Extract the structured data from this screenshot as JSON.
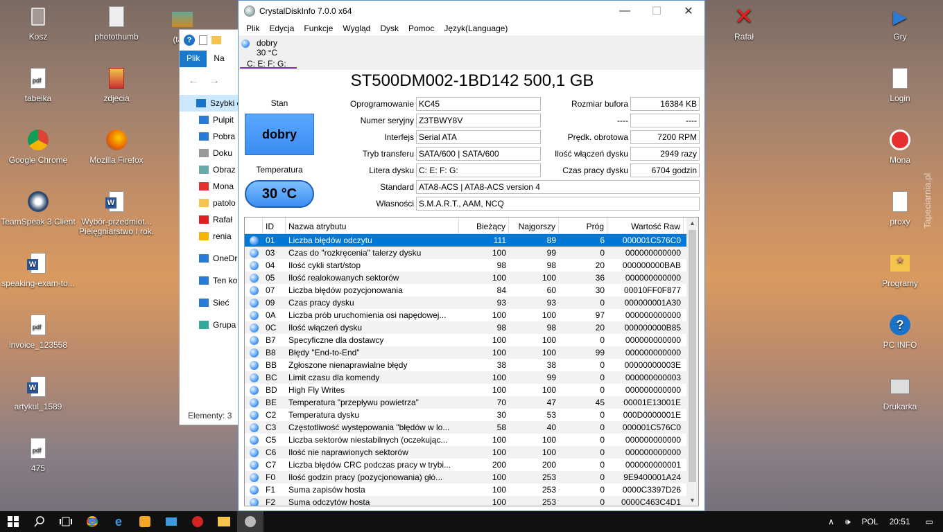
{
  "desktop_left": [
    {
      "label": "Kosz",
      "icon": "recycle-bin-icon"
    },
    {
      "label": "photothumb",
      "icon": "settings-file-icon"
    },
    {
      "label": "(tape",
      "icon": "image-file-icon"
    },
    {
      "label": "tabelka",
      "icon": "pdf-file-icon"
    },
    {
      "label": "zdjecia",
      "icon": "archive-file-icon"
    },
    {
      "label": "Google Chrome",
      "icon": "chrome-icon"
    },
    {
      "label": "Mozilla Firefox",
      "icon": "firefox-icon"
    },
    {
      "label": "TeamSpeak 3 Client",
      "icon": "teamspeak-icon"
    },
    {
      "label": "Wybór-przedmiot... Pielęgniarstwo I rok.",
      "icon": "word-file-icon"
    },
    {
      "label": "speaking-exam-to...",
      "icon": "word-file-icon"
    },
    {
      "label": "invoice_123558",
      "icon": "pdf-file-icon"
    },
    {
      "label": "artykul_1589",
      "icon": "word-file-icon"
    },
    {
      "label": "475",
      "icon": "pdf-file-icon"
    }
  ],
  "desktop_right": [
    {
      "label": "Rafał",
      "icon": "red-x-icon"
    },
    {
      "label": "Gry",
      "icon": "play-icon"
    },
    {
      "label": "Login",
      "icon": "document-icon"
    },
    {
      "label": "Mona",
      "icon": "no-entry-icon"
    },
    {
      "label": "proxy",
      "icon": "document-icon"
    },
    {
      "label": "Programy",
      "icon": "star-folder-icon"
    },
    {
      "label": "PC INFO",
      "icon": "help-icon"
    },
    {
      "label": "Drukarka",
      "icon": "printer-icon"
    }
  ],
  "watermark": "Tapeciarnia.pl",
  "explorer": {
    "tab_active": "Plik",
    "tab_other": "Na",
    "items": [
      "Szybki d",
      "Pulpit",
      "Pobra",
      "Doku",
      "Obraz",
      "Mona",
      "patolo",
      "Rafał",
      "renia",
      "OneDriv",
      "Ten kor",
      "Sieć",
      "Grupa d"
    ],
    "status": "Elementy: 3"
  },
  "cdi": {
    "window_title": "CrystalDiskInfo 7.0.0 x64",
    "menu": [
      "Plik",
      "Edycja",
      "Funkcje",
      "Wygląd",
      "Dysk",
      "Pomoc",
      "Język(Language)"
    ],
    "drive_tab": {
      "status": "dobry",
      "temp": "30 °C",
      "letters": "C: E: F: G:"
    },
    "model": "ST500DM002-1BD142 500,1 GB",
    "health_label": "Stan",
    "health_value": "dobry",
    "temp_label": "Temperatura",
    "temp_value": "30 °C",
    "firmware_label": "Oprogramowanie",
    "firmware": "KC45",
    "serial_label": "Numer seryjny",
    "serial": "Z3TBWY8V",
    "interface_label": "Interfejs",
    "interface": "Serial ATA",
    "transfer_label": "Tryb transferu",
    "transfer": "SATA/600 | SATA/600",
    "letter_label": "Litera dysku",
    "letter": "C: E: F: G:",
    "standard_label": "Standard",
    "standard": "ATA8-ACS | ATA8-ACS version 4",
    "features_label": "Własności",
    "features": "S.M.A.R.T., AAM, NCQ",
    "buffer_label": "Rozmiar bufora",
    "buffer": "16384 KB",
    "blank_label": "----",
    "blank": "----",
    "rpm_label": "Prędk. obrotowa",
    "rpm": "7200 RPM",
    "power_count_label": "Ilość włączeń dysku",
    "power_count": "2949 razy",
    "power_hours_label": "Czas pracy dysku",
    "power_hours": "6704 godzin",
    "table_headers": [
      "ID",
      "Nazwa atrybutu",
      "Bieżący",
      "Najgorszy",
      "Próg",
      "Wartość Raw"
    ],
    "rows": [
      [
        "01",
        "Liczba błędów odczytu",
        "111",
        "89",
        "6",
        "000001C576C0"
      ],
      [
        "03",
        "Czas do \"rozkręcenia\" talerzy dysku",
        "100",
        "99",
        "0",
        "000000000000"
      ],
      [
        "04",
        "Ilość cykli start/stop",
        "98",
        "98",
        "20",
        "000000000BAB"
      ],
      [
        "05",
        "Ilość realokowanych sektorów",
        "100",
        "100",
        "36",
        "000000000000"
      ],
      [
        "07",
        "Liczba błędów pozycjonowania",
        "84",
        "60",
        "30",
        "00010FF0F877"
      ],
      [
        "09",
        "Czas pracy dysku",
        "93",
        "93",
        "0",
        "000000001A30"
      ],
      [
        "0A",
        "Liczba prób uruchomienia osi napędowej...",
        "100",
        "100",
        "97",
        "000000000000"
      ],
      [
        "0C",
        "Ilość włączeń dysku",
        "98",
        "98",
        "20",
        "000000000B85"
      ],
      [
        "B7",
        "Specyficzne dla dostawcy",
        "100",
        "100",
        "0",
        "000000000000"
      ],
      [
        "B8",
        "Błędy \"End-to-End\"",
        "100",
        "100",
        "99",
        "000000000000"
      ],
      [
        "BB",
        "Zgłoszone nienaprawialne błędy",
        "38",
        "38",
        "0",
        "00000000003E"
      ],
      [
        "BC",
        "Limit czasu dla komendy",
        "100",
        "99",
        "0",
        "000000000003"
      ],
      [
        "BD",
        "High Fly Writes",
        "100",
        "100",
        "0",
        "000000000000"
      ],
      [
        "BE",
        "Temperatura \"przepływu powietrza\"",
        "70",
        "47",
        "45",
        "00001E13001E"
      ],
      [
        "C2",
        "Temperatura dysku",
        "30",
        "53",
        "0",
        "000D0000001E"
      ],
      [
        "C3",
        "Częstotliwość występowania \"błędów w lo...",
        "58",
        "40",
        "0",
        "000001C576C0"
      ],
      [
        "C5",
        "Liczba sektorów niestabilnych (oczekując...",
        "100",
        "100",
        "0",
        "000000000000"
      ],
      [
        "C6",
        "Ilość nie naprawionych sektorów",
        "100",
        "100",
        "0",
        "000000000000"
      ],
      [
        "C7",
        "Liczba błędów CRC podczas pracy w trybi...",
        "200",
        "200",
        "0",
        "000000000001"
      ],
      [
        "F0",
        "Ilość godzin pracy (pozycjonowania) głó...",
        "100",
        "253",
        "0",
        "9E9400001A24"
      ],
      [
        "F1",
        "Suma zapisów hosta",
        "100",
        "253",
        "0",
        "0000C3397D26"
      ],
      [
        "F2",
        "Suma odczytów hosta",
        "100",
        "253",
        "0",
        "0000C463C4D1"
      ]
    ]
  },
  "taskbar": {
    "language": "POL",
    "time": "20:51"
  }
}
